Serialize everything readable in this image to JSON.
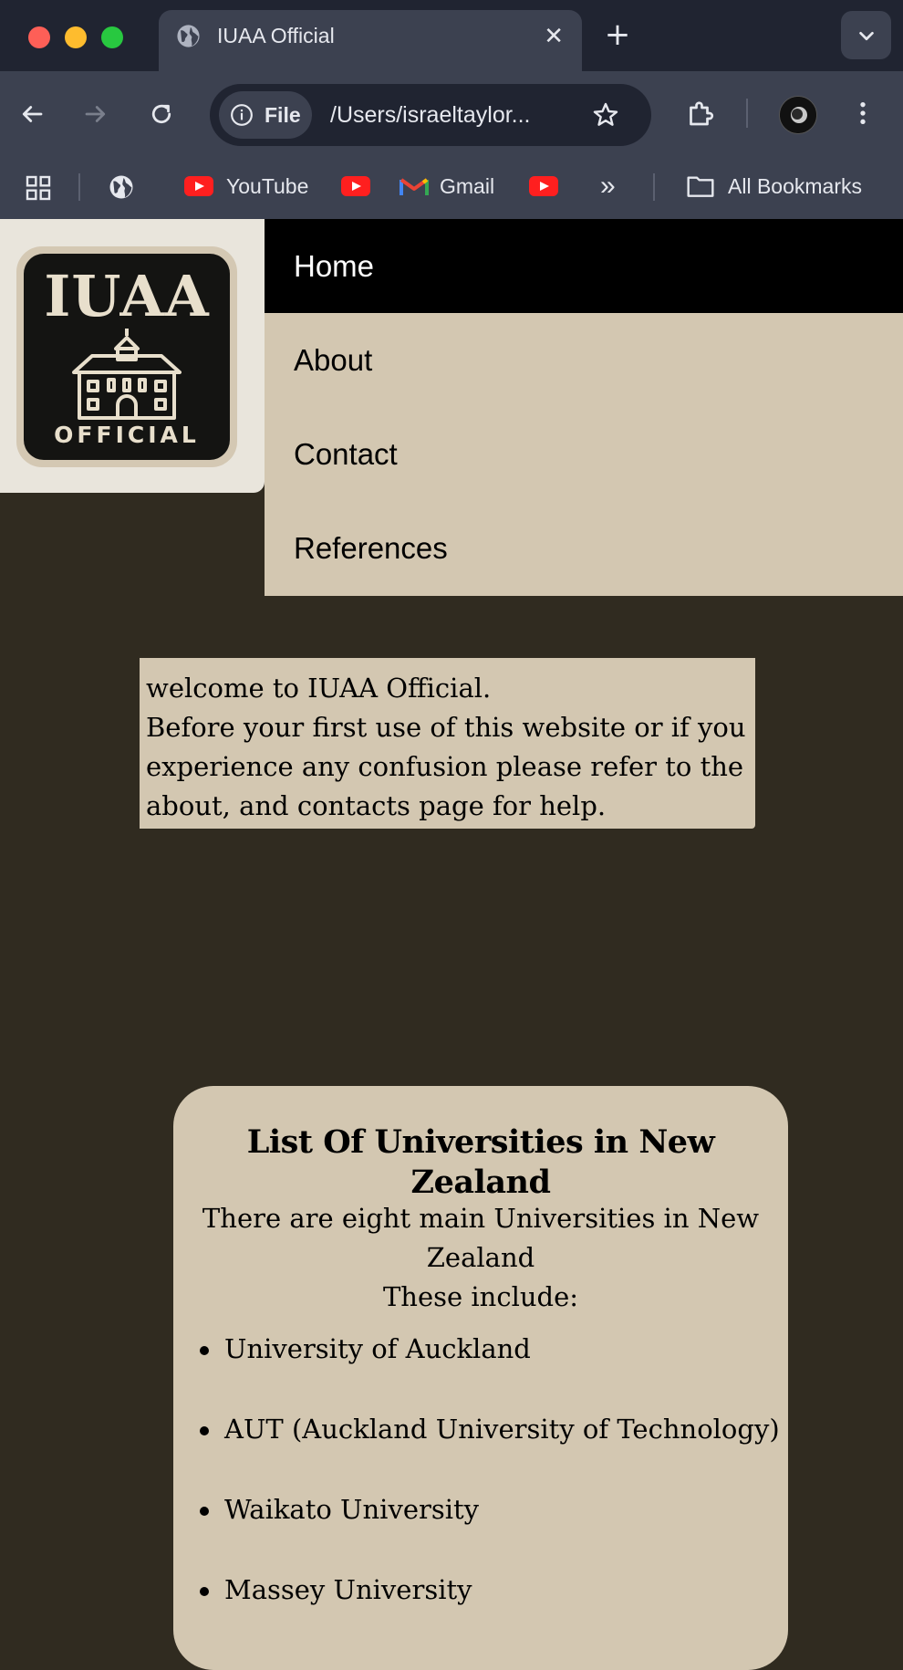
{
  "browser": {
    "tab_title": "IUAA Official",
    "tab_close": "✕",
    "new_tab": "+",
    "file_chip_label": "File",
    "url": "/Users/israeltaylor...",
    "bookmarks": [
      {
        "label": "YouTube",
        "icon": "youtube-icon"
      },
      {
        "label": "",
        "icon": "youtube-icon"
      },
      {
        "label": "Gmail",
        "icon": "gmail-icon"
      },
      {
        "label": "",
        "icon": "youtube-icon"
      }
    ],
    "more_bookmarks": "»",
    "all_bookmarks": "All Bookmarks"
  },
  "logo": {
    "top_text": "IUAA",
    "bottom_text": "OFFICIAL"
  },
  "nav": {
    "items": [
      {
        "label": "Home",
        "active": true
      },
      {
        "label": "About"
      },
      {
        "label": "Contact"
      },
      {
        "label": "References"
      }
    ]
  },
  "welcome": {
    "line1": "welcome to IUAA Official.",
    "line2": "Before your first use of this website or if you experience any confusion please refer to the about, and contacts page for help."
  },
  "universities": {
    "title": "List Of Universities in New Zealand",
    "intro1": "There are eight main Universities in New Zealand",
    "intro2": "These include:",
    "items": [
      "University of Auckland",
      "AUT (Auckland University of Technology)",
      "Waikato University",
      "Massey University"
    ]
  },
  "colors": {
    "page_background": "#302b20",
    "panel": "#d3c7b1",
    "nav_active": "#000000",
    "chrome": "#3c4150",
    "tabstrip": "#202431"
  }
}
